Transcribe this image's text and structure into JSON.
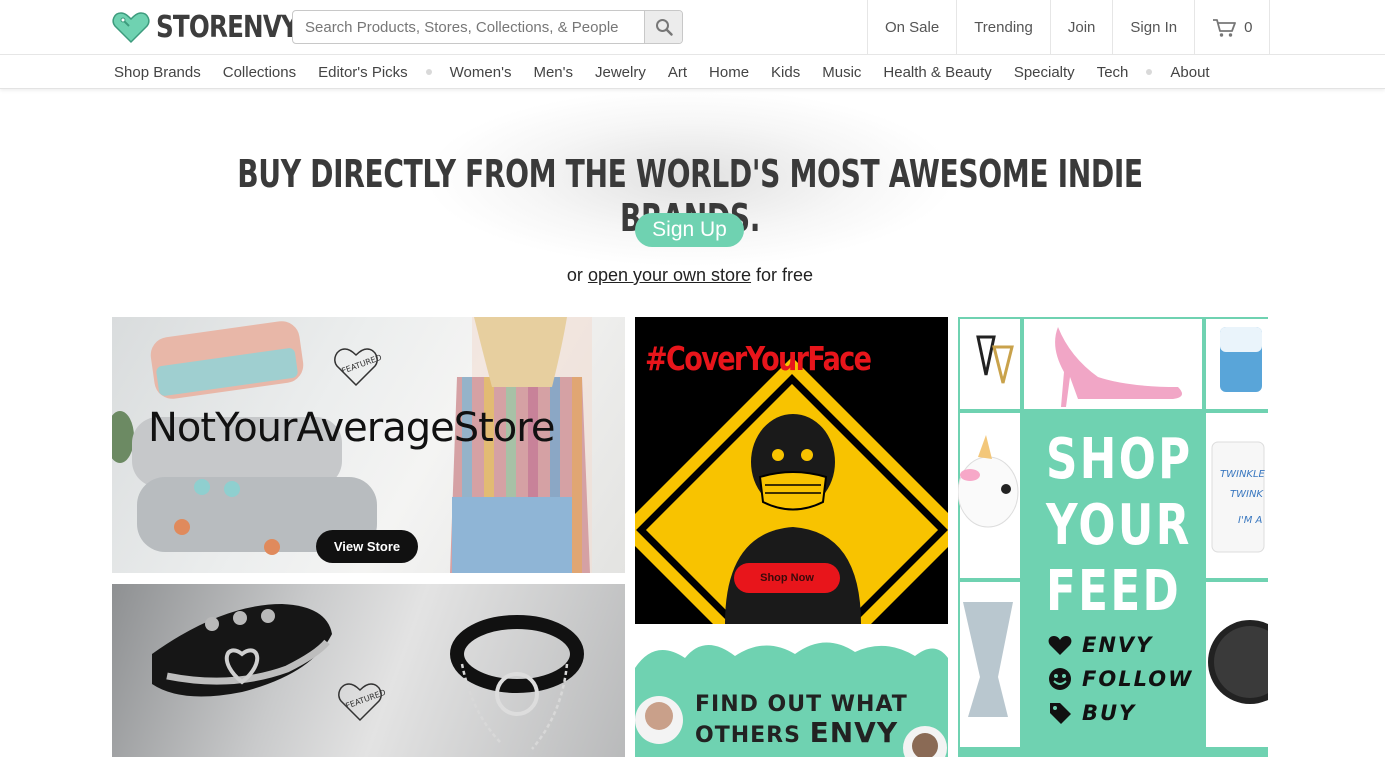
{
  "header": {
    "logo_text": "STORENVY",
    "search_placeholder": "Search Products, Stores, Collections, & People",
    "nav": [
      "On Sale",
      "Trending",
      "Join",
      "Sign In"
    ],
    "cart_count": "0",
    "brand_color": "#6fd2b1"
  },
  "categories": {
    "group1": [
      "Shop Brands",
      "Collections",
      "Editor's Picks"
    ],
    "group2": [
      "Women's",
      "Men's",
      "Jewelry",
      "Art",
      "Home",
      "Kids",
      "Music",
      "Health & Beauty",
      "Specialty",
      "Tech"
    ],
    "group3": [
      "About"
    ]
  },
  "hero": {
    "title": "BUY DIRECTLY FROM THE WORLD'S MOST AWESOME INDIE BRANDS.",
    "signup_label": "Sign Up",
    "sub_prefix": "or ",
    "sub_link": "open your own store",
    "sub_suffix": " for free"
  },
  "tiles": {
    "featured_store": {
      "title": "NotYourAverageStore",
      "badge": "FEATURED BRAND",
      "button": "View Store"
    },
    "cover_face": {
      "hashtag": "#CoverYourFace",
      "button": "Shop Now",
      "accent": "#e8151b",
      "sign_color": "#f8c300"
    },
    "shop_feed": {
      "lines": [
        "SHOP",
        "YOUR",
        "FEED"
      ],
      "actions": [
        "ENVY",
        "FOLLOW",
        "BUY"
      ]
    },
    "chokers": {
      "badge": "FEATURED BRAND"
    },
    "find_out": {
      "line1": "FIND OUT WHAT",
      "line2_prefix": "OTHERS ",
      "line2_bold": "ENVY"
    }
  }
}
